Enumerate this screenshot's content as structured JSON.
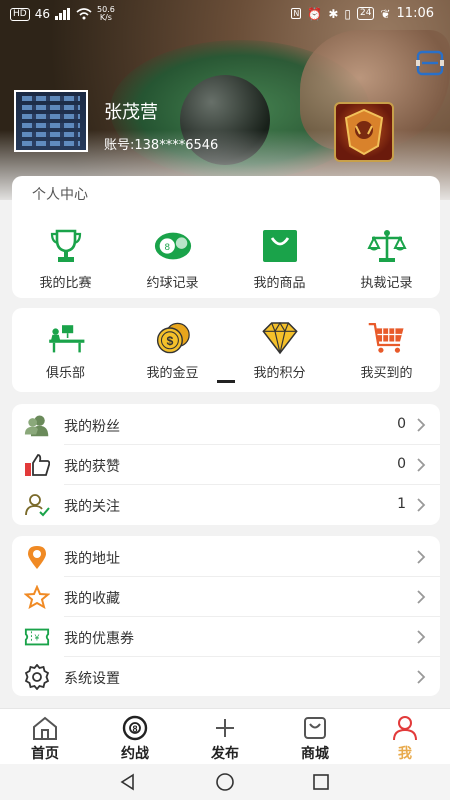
{
  "status_bar": {
    "left": [
      "HD",
      "46",
      "50.6",
      "K/s"
    ],
    "battery": "24",
    "time": "11:06"
  },
  "profile": {
    "username": "张茂营",
    "account": "账号:138****6546"
  },
  "personal_center": {
    "title": "个人中心",
    "items": [
      {
        "label": "我的比赛",
        "icon": "trophy-icon"
      },
      {
        "label": "约球记录",
        "icon": "billiard-ball-icon"
      },
      {
        "label": "我的商品",
        "icon": "shopping-bag-icon"
      },
      {
        "label": "执裁记录",
        "icon": "scales-icon"
      }
    ]
  },
  "wallet": {
    "items": [
      {
        "label": "俱乐部",
        "icon": "club-icon"
      },
      {
        "label": "我的金豆",
        "icon": "gold-coins-icon"
      },
      {
        "label": "我的积分",
        "icon": "diamond-icon"
      },
      {
        "label": "我买到的",
        "icon": "shopping-cart-icon"
      }
    ]
  },
  "social": [
    {
      "label": "我的粉丝",
      "count": "0",
      "icon": "fans-icon"
    },
    {
      "label": "我的获赞",
      "count": "0",
      "icon": "thumbs-up-icon"
    },
    {
      "label": "我的关注",
      "count": "1",
      "icon": "follow-icon"
    }
  ],
  "misc": [
    {
      "label": "我的地址",
      "icon": "location-icon"
    },
    {
      "label": "我的收藏",
      "icon": "star-icon"
    },
    {
      "label": "我的优惠券",
      "icon": "coupon-icon"
    },
    {
      "label": "系统设置",
      "icon": "gear-icon"
    }
  ],
  "tabs": [
    {
      "label": "首页",
      "icon": "home-icon"
    },
    {
      "label": "约战",
      "icon": "eight-ball-icon"
    },
    {
      "label": "发布",
      "icon": "plus-icon"
    },
    {
      "label": "商城",
      "icon": "shop-bag-icon"
    },
    {
      "label": "我",
      "icon": "user-icon",
      "active": true
    }
  ],
  "colors": {
    "accent": "#e8a94a",
    "green": "#1aa34a",
    "orange": "#f08a24",
    "red": "#e23a3a"
  }
}
